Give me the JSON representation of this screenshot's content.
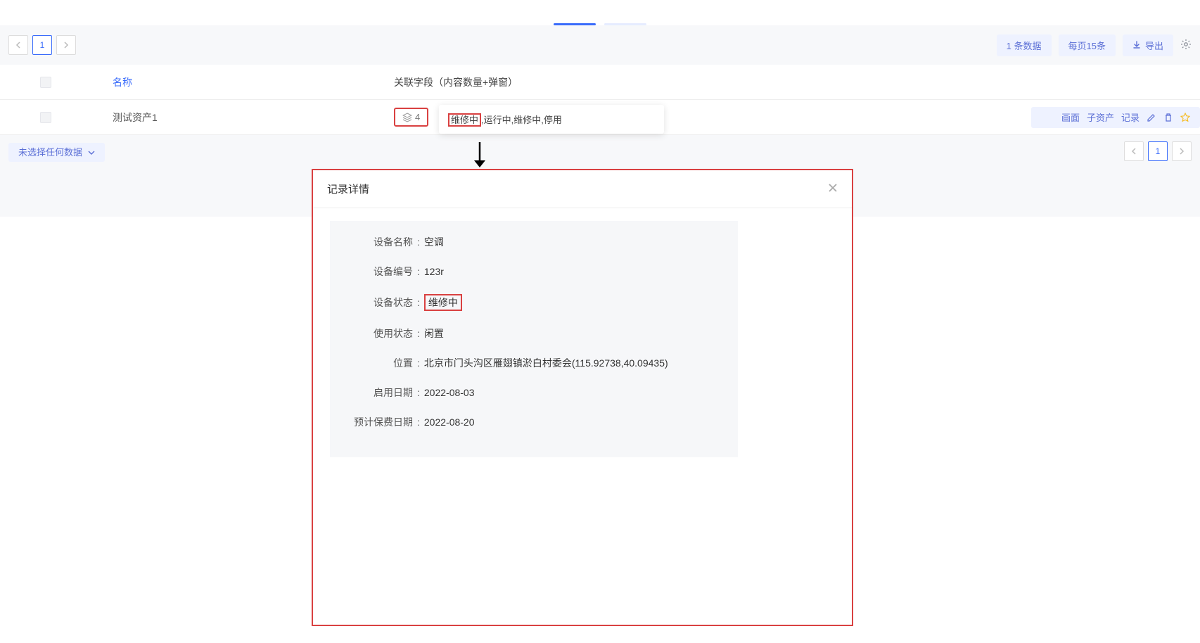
{
  "tabs": {
    "active": true
  },
  "toolbar": {
    "page_current": "1",
    "data_count": "1 条数据",
    "page_size": "每页15条",
    "export": "导出"
  },
  "table": {
    "headers": {
      "name": "名称",
      "related": "关联字段（内容数量+弹窗）"
    },
    "row": {
      "name": "测试资产1",
      "rel_count": "4",
      "rel_items_first": "维修中",
      "rel_items_rest": ",运行中,维修中,停用",
      "actions": {
        "screen": "画面",
        "sub": "子资产",
        "record": "记录"
      }
    }
  },
  "footer": {
    "none_selected": "未选择任何数据",
    "page_current": "1"
  },
  "modal": {
    "title": "记录详情",
    "fields": {
      "device_name_label": "设备名称",
      "device_name": "空调",
      "device_no_label": "设备编号",
      "device_no": "123r",
      "device_status_label": "设备状态",
      "device_status": "维修中",
      "use_status_label": "使用状态",
      "use_status": "闲置",
      "location_label": "位置",
      "location": "北京市门头沟区雁翅镇淤白村委会(115.92738,40.09435)",
      "enable_date_label": "启用日期",
      "enable_date": "2022-08-03",
      "warranty_date_label": "预计保费日期",
      "warranty_date": "2022-08-20"
    }
  }
}
